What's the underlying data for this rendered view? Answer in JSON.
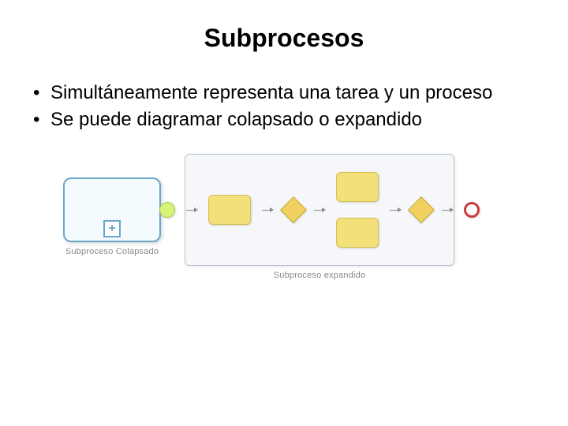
{
  "title": "Subprocesos",
  "bullets": [
    "Simultáneamente representa una tarea y un proceso",
    "Se puede diagramar colapsado o expandido"
  ],
  "diagram": {
    "collapsed": {
      "plus_symbol": "+",
      "label": "Subproceso Colapsado"
    },
    "expanded": {
      "label": "Subproceso expandido"
    }
  }
}
